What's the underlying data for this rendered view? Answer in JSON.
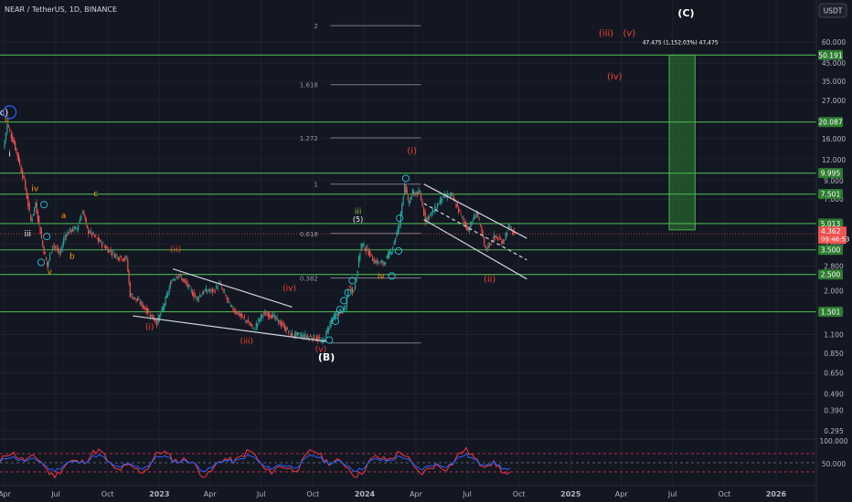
{
  "header": {
    "symbol_line": "NEAR / TetherUS, 1D, BINANCE",
    "currency_button": "USDT"
  },
  "colors": {
    "background": "#131722",
    "candle_up": "#26a69a",
    "candle_down": "#ef5350",
    "level_line": "#4caf50",
    "target_box": "#2e7d32",
    "fib_line": "#787b86",
    "channel_line": "#d1d4dc",
    "wave_white": "#ffffff",
    "wave_orange": "#ff9800",
    "wave_red": "#f44336",
    "wave_green": "#8bc34a",
    "wave_cyan": "#26c6da",
    "wave_blue": "#2962ff",
    "rsi_red": "#f23645",
    "rsi_blue": "#2962ff"
  },
  "chart_data": {
    "type": "candlestick",
    "y_scale": "log",
    "ylim": [
      0.27,
      75
    ],
    "y_ticks": [
      "60.000",
      "45.000",
      "35.000",
      "27.000",
      "16.000",
      "12.000",
      "9.000",
      "7.000",
      "5.000",
      "3.800",
      "2.800",
      "2.000",
      "1.500",
      "1.100",
      "0.850",
      "0.650",
      "0.490",
      "0.390",
      "0.295"
    ],
    "x_ticks": [
      "Apr",
      "Jul",
      "Oct",
      "2023",
      "Apr",
      "Jul",
      "Oct",
      "2024",
      "Apr",
      "Jul",
      "Oct",
      "2025",
      "Apr",
      "Jul",
      "Oct",
      "2026"
    ],
    "price_path": [
      [
        "2022-04-01",
        14.0
      ],
      [
        "2022-04-08",
        19.5
      ],
      [
        "2022-04-20",
        15.0
      ],
      [
        "2022-04-28",
        12.0
      ],
      [
        "2022-05-08",
        9.0
      ],
      [
        "2022-05-20",
        5.2
      ],
      [
        "2022-05-28",
        6.6
      ],
      [
        "2022-06-10",
        3.7
      ],
      [
        "2022-06-18",
        2.8
      ],
      [
        "2022-06-28",
        3.8
      ],
      [
        "2022-07-10",
        3.3
      ],
      [
        "2022-07-20",
        4.3
      ],
      [
        "2022-07-31",
        4.6
      ],
      [
        "2022-08-10",
        4.7
      ],
      [
        "2022-08-20",
        6.0
      ],
      [
        "2022-08-28",
        4.6
      ],
      [
        "2022-09-10",
        4.2
      ],
      [
        "2022-09-30",
        3.6
      ],
      [
        "2022-10-20",
        3.2
      ],
      [
        "2022-11-06",
        3.1
      ],
      [
        "2022-11-12",
        1.9
      ],
      [
        "2022-11-30",
        1.7
      ],
      [
        "2022-12-20",
        1.42
      ],
      [
        "2022-12-30",
        1.3
      ],
      [
        "2023-01-10",
        1.6
      ],
      [
        "2023-01-25",
        2.3
      ],
      [
        "2023-02-05",
        2.5
      ],
      [
        "2023-02-20",
        2.2
      ],
      [
        "2023-03-10",
        1.8
      ],
      [
        "2023-03-25",
        2.0
      ],
      [
        "2023-04-10",
        2.0
      ],
      [
        "2023-04-20",
        2.2
      ],
      [
        "2023-05-10",
        1.6
      ],
      [
        "2023-06-10",
        1.3
      ],
      [
        "2023-06-20",
        1.18
      ],
      [
        "2023-07-05",
        1.45
      ],
      [
        "2023-07-20",
        1.45
      ],
      [
        "2023-08-10",
        1.25
      ],
      [
        "2023-08-25",
        1.1
      ],
      [
        "2023-09-15",
        1.08
      ],
      [
        "2023-10-10",
        1.05
      ],
      [
        "2023-10-20",
        0.98
      ],
      [
        "2023-11-05",
        1.35
      ],
      [
        "2023-11-20",
        1.5
      ],
      [
        "2023-11-30",
        1.55
      ],
      [
        "2023-12-05",
        2.1
      ],
      [
        "2023-12-15",
        2.0
      ],
      [
        "2023-12-28",
        3.8
      ],
      [
        "2024-01-10",
        3.4
      ],
      [
        "2024-01-20",
        3.0
      ],
      [
        "2024-02-05",
        2.9
      ],
      [
        "2024-02-20",
        3.5
      ],
      [
        "2024-03-05",
        5.0
      ],
      [
        "2024-03-14",
        8.7
      ],
      [
        "2024-03-20",
        6.6
      ],
      [
        "2024-03-28",
        7.6
      ],
      [
        "2024-04-10",
        7.6
      ],
      [
        "2024-04-20",
        5.3
      ],
      [
        "2024-05-05",
        6.0
      ],
      [
        "2024-05-20",
        7.2
      ],
      [
        "2024-06-05",
        7.4
      ],
      [
        "2024-06-20",
        5.8
      ],
      [
        "2024-07-05",
        4.6
      ],
      [
        "2024-07-20",
        5.9
      ],
      [
        "2024-08-05",
        3.5
      ],
      [
        "2024-08-20",
        4.2
      ],
      [
        "2024-09-05",
        3.9
      ],
      [
        "2024-09-15",
        4.8
      ],
      [
        "2024-09-25",
        4.36
      ]
    ],
    "levels": [
      50.191,
      20.087,
      9.995,
      7.501,
      5.013,
      3.5,
      2.5,
      1.501
    ],
    "current_price": "4.362",
    "countdown": "09:46:53",
    "level_labels": [
      "50.191",
      "20.087",
      "9.995",
      "7.501",
      "5.013",
      "3.500",
      "2.500",
      "1.501"
    ],
    "fib_levels": [
      {
        "label": "2",
        "price": 75
      },
      {
        "label": "1.618",
        "price": 33.5
      },
      {
        "label": "1.272",
        "price": 16.2
      },
      {
        "label": "1",
        "price": 8.6
      },
      {
        "label": "0.618",
        "price": 4.38
      },
      {
        "label": "0.382",
        "price": 2.38
      },
      {
        "label": "",
        "price": 0.98
      }
    ],
    "target_box": {
      "from_date": "2025-06-25",
      "to_date": "2025-08-10",
      "low": 4.6,
      "high": 50.191,
      "label": "47.475 (1,152.03%) 47,475"
    },
    "wave_labels": [
      {
        "text": "(C)",
        "date": "2025-07-25",
        "price": 85,
        "color": "wave_white",
        "size": 11,
        "bold": true
      },
      {
        "text": "(iii)",
        "date": "2025-03-05",
        "price": 65,
        "color": "wave_red",
        "size": 10
      },
      {
        "text": "(v)",
        "date": "2025-04-15",
        "price": 65,
        "color": "wave_red",
        "size": 10
      },
      {
        "text": "(iv)",
        "date": "2025-03-20",
        "price": 36,
        "color": "wave_red",
        "size": 10
      },
      {
        "text": "(B)",
        "date": "2023-10-25",
        "price": 0.77,
        "color": "wave_white",
        "size": 11,
        "bold": true
      },
      {
        "text": "(c)",
        "date": "2022-03-28",
        "price": 22,
        "color": "wave_white",
        "size": 10
      },
      {
        "text": "ii",
        "date": "2022-04-05",
        "price": 20,
        "color": "wave_orange",
        "size": 9
      },
      {
        "text": "i",
        "date": "2022-04-10",
        "price": 12.5,
        "color": "wave_white",
        "size": 9
      },
      {
        "text": "iv",
        "date": "2022-05-25",
        "price": 7.8,
        "color": "wave_orange",
        "size": 9
      },
      {
        "text": "iii",
        "date": "2022-05-12",
        "price": 4.2,
        "color": "wave_white",
        "size": 9
      },
      {
        "text": "v",
        "date": "2022-06-20",
        "price": 2.5,
        "color": "wave_orange",
        "size": 9
      },
      {
        "text": "a",
        "date": "2022-07-15",
        "price": 5.4,
        "color": "wave_orange",
        "size": 9
      },
      {
        "text": "b",
        "date": "2022-07-30",
        "price": 3.1,
        "color": "wave_orange",
        "size": 9
      },
      {
        "text": "c",
        "date": "2022-09-10",
        "price": 7.3,
        "color": "wave_orange",
        "size": 9
      },
      {
        "text": "(i)",
        "date": "2022-12-15",
        "price": 1.18,
        "color": "wave_red",
        "size": 9
      },
      {
        "text": "(ii)",
        "date": "2023-01-30",
        "price": 3.4,
        "color": "wave_red",
        "size": 9
      },
      {
        "text": "(iii)",
        "date": "2023-06-05",
        "price": 0.97,
        "color": "wave_red",
        "size": 9
      },
      {
        "text": "(iv)",
        "date": "2023-08-20",
        "price": 2.0,
        "color": "wave_red",
        "size": 9
      },
      {
        "text": "(v)",
        "date": "2023-10-15",
        "price": 0.87,
        "color": "wave_red",
        "size": 9
      },
      {
        "text": "iii",
        "date": "2023-12-20",
        "price": 5.7,
        "color": "wave_green",
        "size": 9
      },
      {
        "text": "(5)",
        "date": "2023-12-20",
        "price": 5.15,
        "color": "wave_white",
        "size": 8
      },
      {
        "text": "iv",
        "date": "2024-01-30",
        "price": 2.35,
        "color": "wave_orange",
        "size": 9
      },
      {
        "text": "(i)",
        "date": "2024-03-25",
        "price": 13,
        "color": "wave_red",
        "size": 10
      },
      {
        "text": "(ii)",
        "date": "2024-08-10",
        "price": 2.25,
        "color": "wave_red",
        "size": 10
      }
    ],
    "channel_lines": [
      {
        "from": [
          "2024-04-15",
          8.6
        ],
        "to": [
          "2024-10-15",
          4.1
        ],
        "dashed": false
      },
      {
        "from": [
          "2024-04-15",
          5.3
        ],
        "to": [
          "2024-10-15",
          2.35
        ],
        "dashed": false
      },
      {
        "from": [
          "2024-04-15",
          6.6
        ],
        "to": [
          "2024-10-15",
          3.05
        ],
        "dashed": true
      },
      {
        "from": [
          "2023-01-25",
          2.7
        ],
        "to": [
          "2023-08-25",
          1.6
        ],
        "dashed": false
      },
      {
        "from": [
          "2022-11-15",
          1.42
        ],
        "to": [
          "2023-10-25",
          1.0
        ],
        "dashed": false
      }
    ],
    "rsi": {
      "ylim": [
        0,
        100
      ],
      "ticks": [
        "100.000",
        "50.000"
      ],
      "levels": [
        70,
        50,
        30
      ]
    }
  }
}
